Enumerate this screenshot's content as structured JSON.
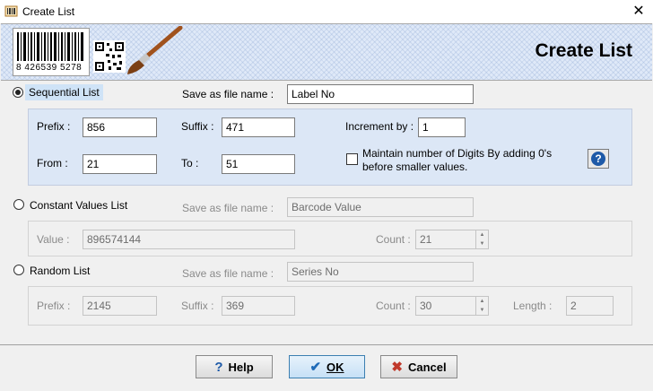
{
  "window": {
    "title": "Create List",
    "close_glyph": "✕"
  },
  "banner": {
    "title": "Create List",
    "barcode_number": "8 426539 5278",
    "logo_icon": "barcode-qr-brush-icon"
  },
  "sequential": {
    "label": "Sequential List",
    "selected": true,
    "save_label": "Save as file name :",
    "save_value": "Label No",
    "prefix_label": "Prefix :",
    "prefix_value": "856",
    "suffix_label": "Suffix :",
    "suffix_value": "471",
    "increment_label": "Increment by :",
    "increment_value": "1",
    "from_label": "From :",
    "from_value": "21",
    "to_label": "To :",
    "to_value": "51",
    "maintain_line1": "Maintain number of Digits By adding 0's",
    "maintain_line2": "before smaller values.",
    "maintain_checked": false
  },
  "constant": {
    "label": "Constant Values List",
    "save_label": "Save as file name :",
    "save_value": "Barcode Value",
    "value_label": "Value :",
    "value_value": "896574144",
    "count_label": "Count :",
    "count_value": "21"
  },
  "random": {
    "label": "Random List",
    "save_label": "Save as file name :",
    "save_value": "Series No",
    "prefix_label": "Prefix :",
    "prefix_value": "2145",
    "suffix_label": "Suffix :",
    "suffix_value": "369",
    "count_label": "Count :",
    "count_value": "30",
    "length_label": "Length :",
    "length_value": "2"
  },
  "buttons": {
    "help": "Help",
    "ok": "OK",
    "cancel": "Cancel"
  },
  "colors": {
    "panel": "#dce7f6",
    "banner": "#dfe9f8",
    "ok_border": "#3c7fb1"
  }
}
